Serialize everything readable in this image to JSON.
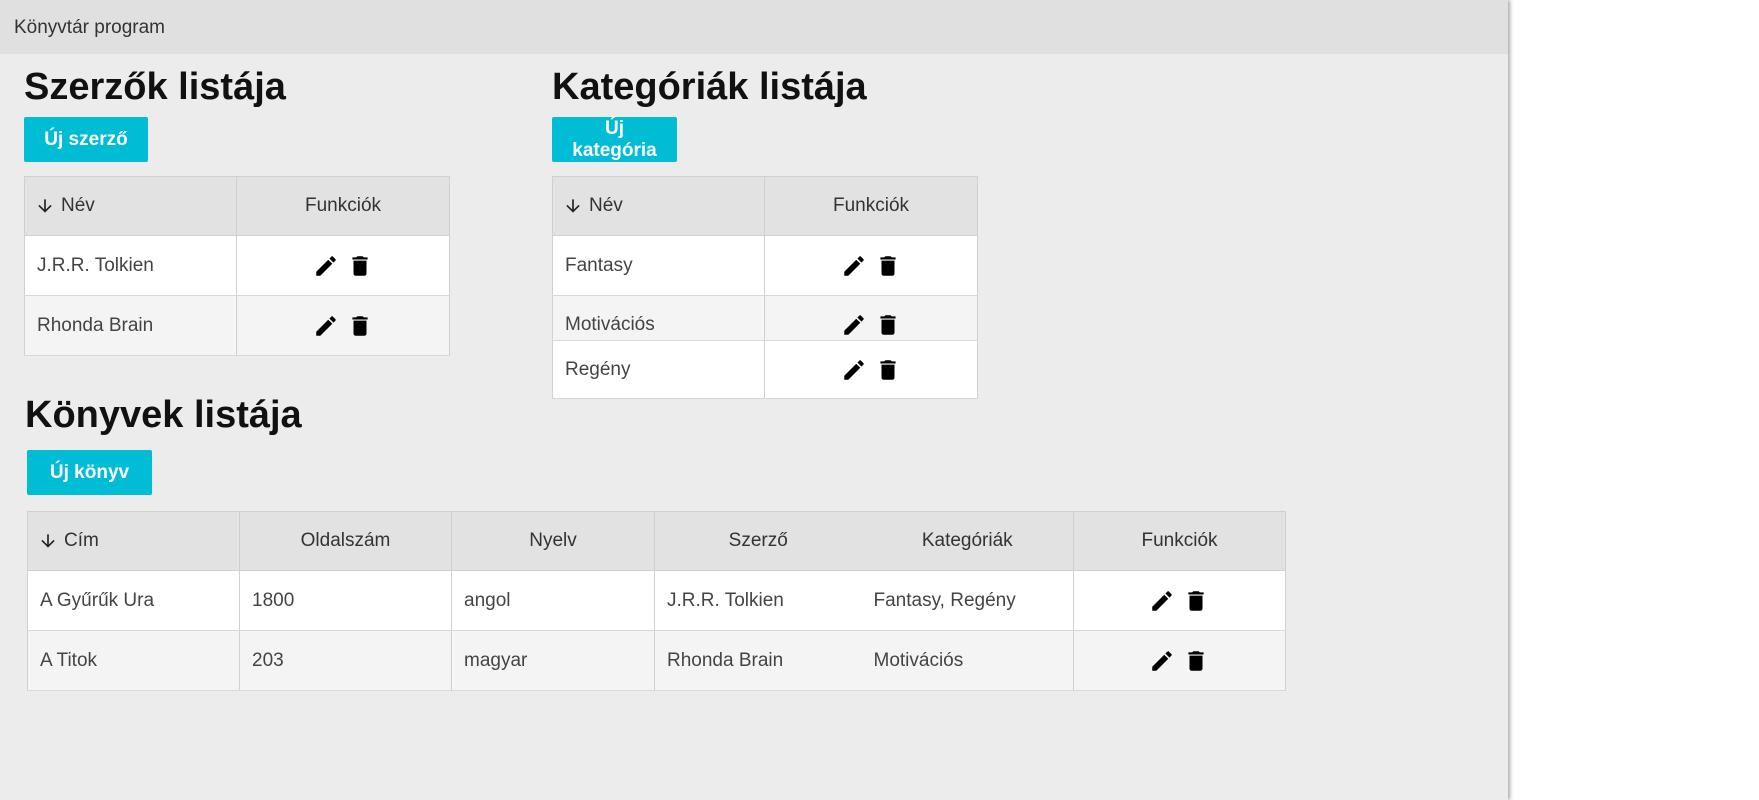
{
  "window": {
    "title": "Könyvtár program"
  },
  "authors": {
    "title": "Szerzők listája",
    "new_button": "Új szerző",
    "columns": {
      "name": "Név",
      "functions": "Funkciók"
    },
    "rows": [
      {
        "name": "J.R.R. Tolkien"
      },
      {
        "name": "Rhonda Brain"
      }
    ]
  },
  "categories": {
    "title": "Kategóriák listája",
    "new_button": "Új kategória",
    "columns": {
      "name": "Név",
      "functions": "Funkciók"
    },
    "rows": [
      {
        "name": "Fantasy"
      },
      {
        "name": "Motivációs"
      },
      {
        "name": "Regény"
      }
    ]
  },
  "books": {
    "title": "Könyvek listája",
    "new_button": "Új könyv",
    "columns": {
      "title": "Cím",
      "pages": "Oldalszám",
      "language": "Nyelv",
      "author": "Szerző",
      "categories": "Kategóriák",
      "functions": "Funkciók"
    },
    "rows": [
      {
        "title": "A Gyűrűk Ura",
        "pages": "1800",
        "language": "angol",
        "author": "J.R.R. Tolkien",
        "categories": "Fantasy, Regény"
      },
      {
        "title": "A Titok",
        "pages": "203",
        "language": "magyar",
        "author": "Rhonda Brain",
        "categories": "Motivációs"
      }
    ]
  },
  "icons": {
    "sort": "arrow-down-icon",
    "edit": "pencil-icon",
    "delete": "trash-icon"
  },
  "colors": {
    "accent": "#00bcd4",
    "window_bg": "#ececec",
    "header_bg": "#e2e2e2"
  }
}
